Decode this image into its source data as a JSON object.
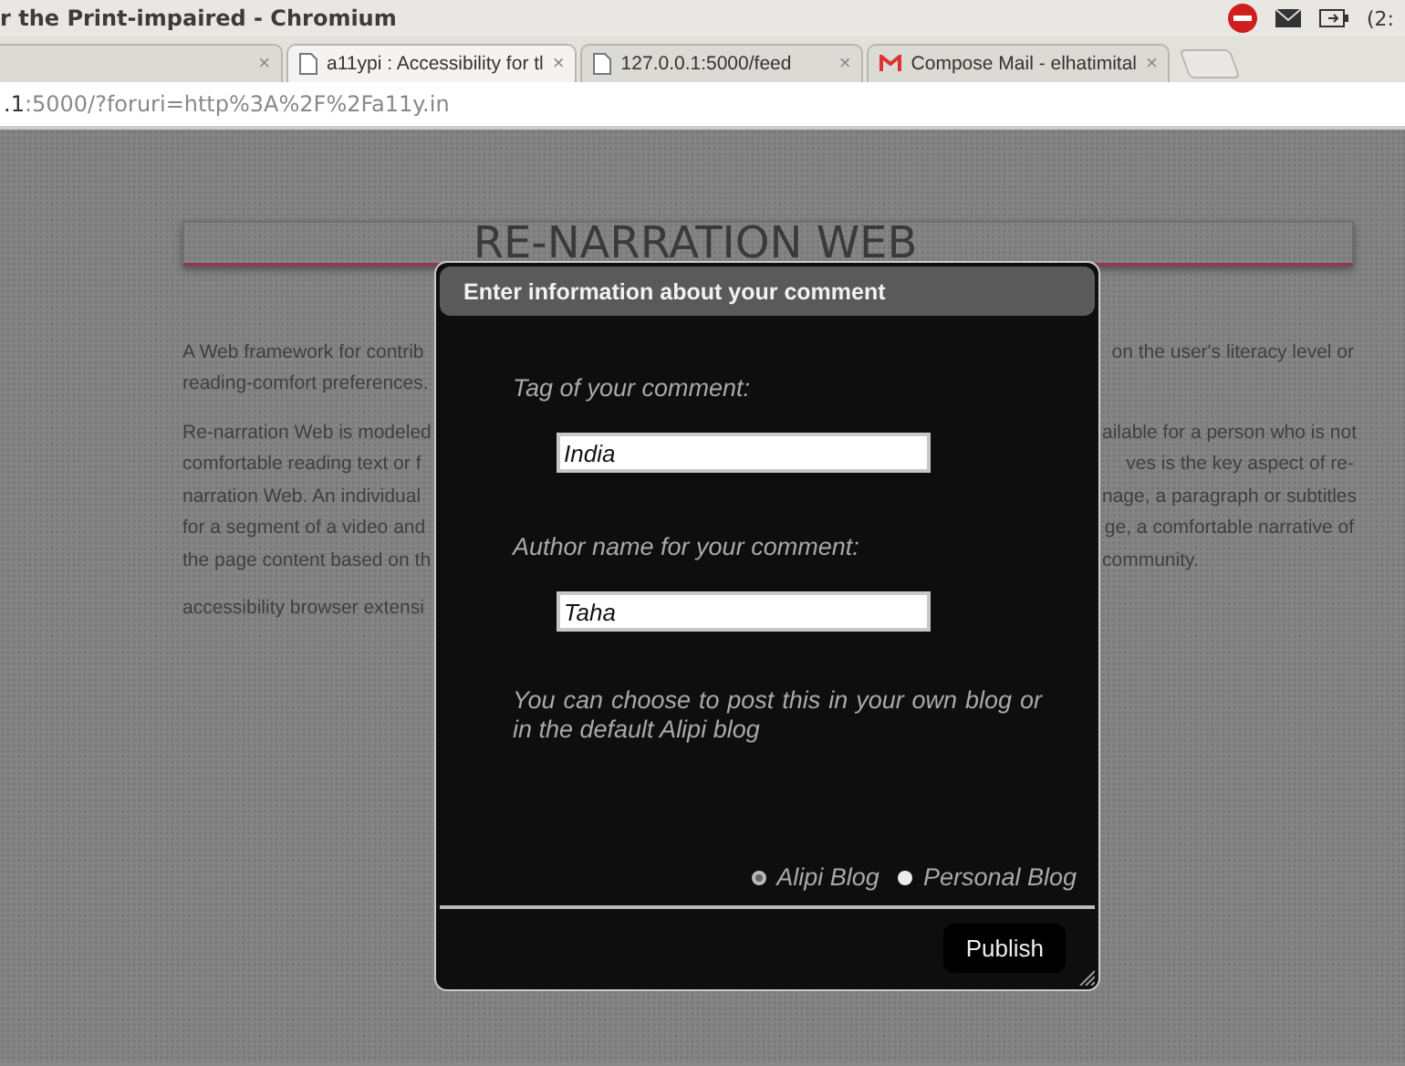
{
  "window": {
    "title": "r the Print-impaired - Chromium",
    "tray": {
      "clock": "(2:"
    }
  },
  "tabs": [
    {
      "close": "×",
      "selected": false
    },
    {
      "label": "a11ypi : Accessibility for tl",
      "close": "×",
      "selected": true
    },
    {
      "label": "127.0.0.1:5000/feed",
      "close": "×",
      "selected": false
    },
    {
      "label": "Compose Mail - elhatimital",
      "close": "×",
      "selected": false
    }
  ],
  "address_bar": {
    "host": ".1",
    "rest": ":5000/?foruri=http%3A%2F%2Fa11y.in"
  },
  "page": {
    "heading": "RE-NARRATION WEB",
    "paragraphs": [
      [
        {
          "left": "A Web framework for contrib",
          "right": "on the user's literacy level or"
        },
        {
          "left": "reading-comfort preferences."
        }
      ],
      [
        {
          "left": "Re-narration Web is modeled",
          "right": "ailable for a person who is not"
        },
        {
          "left": "comfortable reading text or f",
          "right": "ves is the key aspect of re-"
        },
        {
          "left": "narration Web. An individual",
          "right": "nage, a paragraph or subtitles"
        },
        {
          "left": "for a segment of a video and",
          "right": "ge, a comfortable narrative of"
        },
        {
          "left": "the page content based on th",
          "right": "community."
        }
      ],
      [
        {
          "left": "accessibility browser extensi"
        }
      ]
    ]
  },
  "dialog": {
    "title": "Enter information about your comment",
    "fields": [
      {
        "label": "Tag of your comment:",
        "value": "India"
      },
      {
        "label": "Author name for your comment:",
        "value": "Taha"
      }
    ],
    "note": "You can choose to post this in your own blog or in the default Alipi blog",
    "options": [
      {
        "label": "Alipi Blog",
        "selected": true
      },
      {
        "label": "Personal Blog",
        "selected": false
      }
    ],
    "button": "Publish"
  }
}
